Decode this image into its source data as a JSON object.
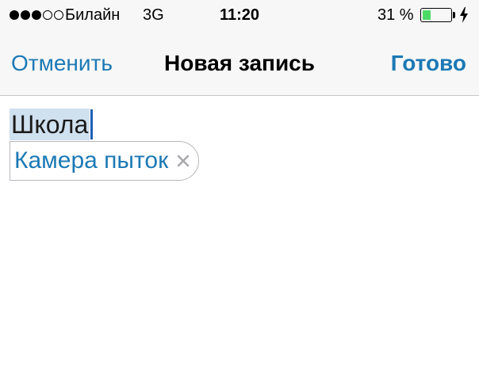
{
  "status_bar": {
    "signal_filled": 3,
    "signal_total": 5,
    "carrier": "Билайн",
    "network": "3G",
    "time": "11:20",
    "battery_percent": "31 %",
    "battery_level": 0.31,
    "charging_icon": "bolt-icon",
    "battery_color": "#4cd964"
  },
  "nav": {
    "cancel_label": "Отменить",
    "title": "Новая запись",
    "done_label": "Готово",
    "accent_color": "#1c79b5"
  },
  "editor": {
    "selected_text": "Школа",
    "tags": [
      {
        "label": "Камера пыток",
        "remove_icon": "close-icon"
      }
    ]
  }
}
